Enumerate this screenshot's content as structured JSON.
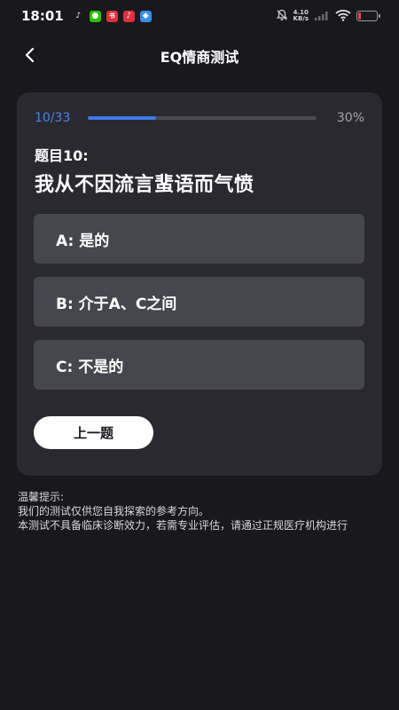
{
  "status_bar": {
    "time": "18:01",
    "app_icons": [
      {
        "name": "tiktok-icon",
        "glyph": "♪",
        "bg": "#18181d",
        "fg": "#ffffff"
      },
      {
        "name": "wechat-icon",
        "glyph": "●",
        "bg": "#2dc100",
        "fg": "#ffffff"
      },
      {
        "name": "xiaohongshu-icon",
        "glyph": "书",
        "bg": "#e0303c",
        "fg": "#ffffff"
      },
      {
        "name": "tiktok-red-icon",
        "glyph": "♪",
        "bg": "#e0303c",
        "fg": "#ffffff"
      },
      {
        "name": "app-blue-icon",
        "glyph": "◆",
        "bg": "#3a8ee6",
        "fg": "#ffffff"
      }
    ],
    "net_speed_value": "4.10",
    "net_speed_unit": "KB/s",
    "battery_level": 0.15,
    "battery_color": "#e04848"
  },
  "nav": {
    "title": "EQ情商测试"
  },
  "progress": {
    "count": "10/33",
    "percent_label": "30%",
    "fraction": 0.3,
    "color": "#3f7ae6"
  },
  "question": {
    "number_label": "题目10:",
    "text": "我从不因流言蜚语而气愤"
  },
  "options": [
    {
      "label": "A: 是的"
    },
    {
      "label": "B: 介于A、C之间"
    },
    {
      "label": "C: 不是的"
    }
  ],
  "prev_button": {
    "label": "上一题"
  },
  "notice": {
    "title": "温馨提示:",
    "line1": "我们的测试仅供您自我探索的参考方向。",
    "line2": "本测试不具备临床诊断效力，若需专业评估，请通过正规医疗机构进行"
  }
}
